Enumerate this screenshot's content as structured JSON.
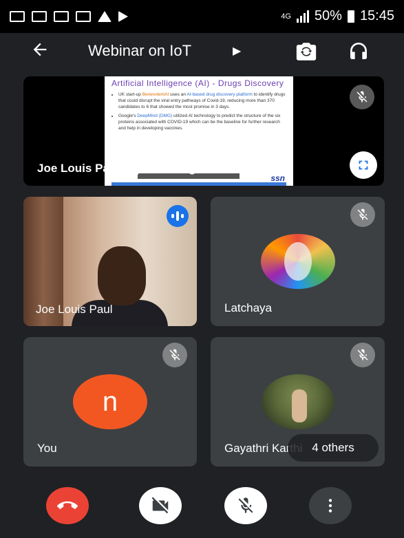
{
  "status_bar": {
    "network": "4G",
    "battery": "50%",
    "time": "15:45"
  },
  "app_bar": {
    "title": "Webinar on IoT",
    "back_icon": "arrow-left-icon",
    "switch_camera_icon": "switch-camera-icon",
    "audio_icon": "headphones-icon"
  },
  "presentation": {
    "name_label": "Joe Louis Paul is presenting",
    "slide": {
      "title": "Artificial Intelligence (AI) - Drugs Discovery",
      "bullet1_pre": "UK start-up ",
      "bullet1_org": "BenevolentAI",
      "bullet1_mid": " uses an ",
      "bullet1_link": "AI-based drug discovery platform",
      "bullet1_post": " to identify drugs that could disrupt the viral entry pathways of Covid-19, reducing more than 370 candidates to 6 that showed the most promise in 3 days.",
      "bullet2_pre": "Google's ",
      "bullet2_org": "DeepMind (DMG)",
      "bullet2_post": " utilized AI technology to predict the structure of the six proteins associated with COVID-19 which can be the baseline for further research and help in developing vaccines.",
      "logo": "ssn"
    }
  },
  "participants": [
    {
      "name": "Joe Louis Paul",
      "speaking": true
    },
    {
      "name": "Latchaya",
      "muted": true
    },
    {
      "name": "You",
      "avatar_letter": "n",
      "muted": true
    },
    {
      "name": "Gayathri Karthi",
      "muted": true
    }
  ],
  "others_label": "4 others",
  "colors": {
    "hangup": "#ea4335",
    "you_avatar": "#f25722",
    "speaking": "#1a73e8"
  }
}
